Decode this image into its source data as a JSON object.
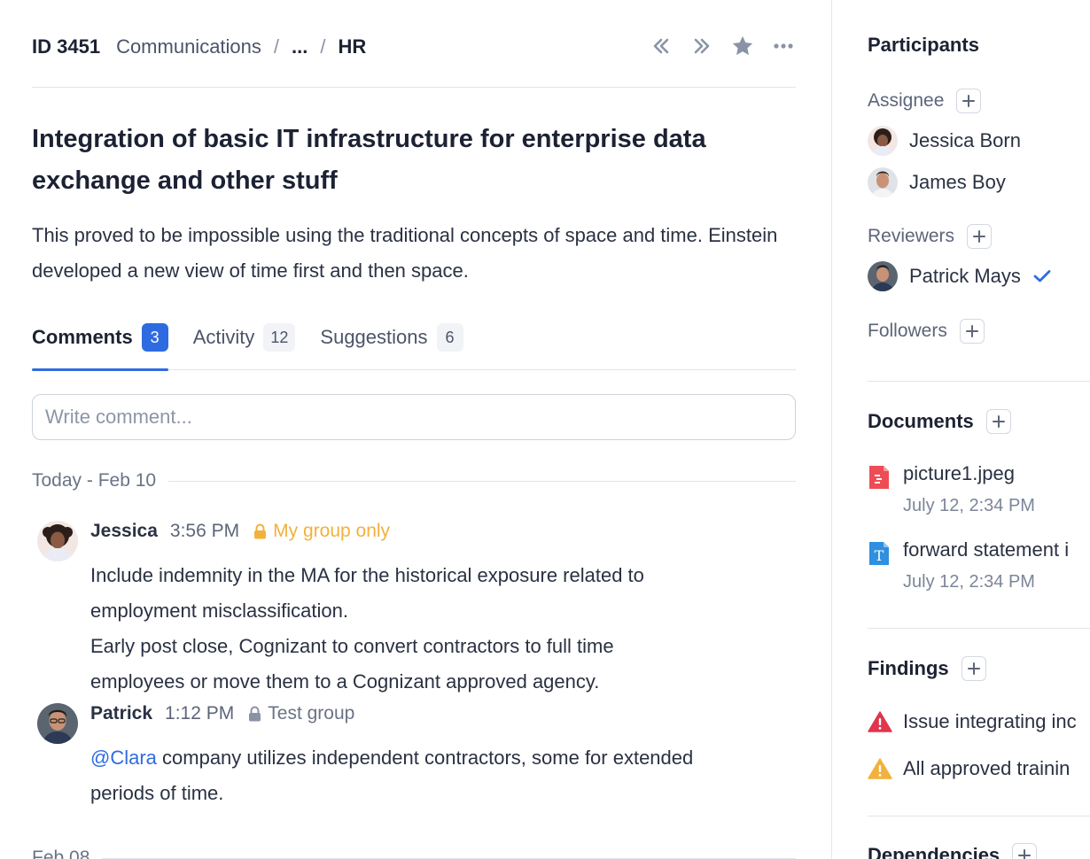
{
  "header": {
    "task_id": "ID 3451",
    "breadcrumb": [
      "Communications",
      "...",
      "HR"
    ],
    "separator": "/"
  },
  "task": {
    "title": "Integration of basic IT infrastructure for enterprise data exchange and other stuff",
    "description": "This proved to be impossible using the traditional concepts of space and time. Einstein developed a new view of time first and then space."
  },
  "tabs": [
    {
      "label": "Comments",
      "count": "3",
      "active": true
    },
    {
      "label": "Activity",
      "count": "12",
      "active": false
    },
    {
      "label": "Suggestions",
      "count": "6",
      "active": false
    }
  ],
  "comment_input": {
    "placeholder": "Write comment..."
  },
  "day_groups": [
    {
      "label": "Today - Feb 10"
    },
    {
      "label": "Feb 08"
    }
  ],
  "comments": [
    {
      "author": "Jessica",
      "time": "3:56 PM",
      "visibility": "My group only",
      "lines": [
        "Include indemnity in the MA for the historical exposure related to",
        "employment misclassification.",
        "Early post close, Cognizant to convert contractors to full time",
        "employees or move them to a Cognizant approved agency."
      ]
    },
    {
      "author": "Patrick",
      "time": "1:12 PM",
      "visibility": "Test group",
      "mention": "@Clara",
      "line1_rest": " company utilizes independent contractors, some for extended",
      "line2": "periods of time."
    }
  ],
  "sidebar": {
    "participants": {
      "heading": "Participants",
      "assignee_label": "Assignee",
      "assignees": [
        "Jessica Born",
        "James Boy"
      ],
      "reviewers_label": "Reviewers",
      "reviewers": [
        "Patrick Mays"
      ],
      "followers_label": "Followers"
    },
    "documents": {
      "heading": "Documents",
      "items": [
        {
          "name": "picture1.jpeg",
          "date": "July 12, 2:34 PM",
          "icon": "image-file-icon"
        },
        {
          "name": "forward statement i",
          "date": "July 12, 2:34 PM",
          "icon": "text-file-icon"
        }
      ]
    },
    "findings": {
      "heading": "Findings",
      "items": [
        {
          "text": "Issue integrating inc",
          "severity": "error"
        },
        {
          "text": "All approved trainin",
          "severity": "warning"
        }
      ]
    },
    "dependencies": {
      "heading": "Dependencies"
    }
  },
  "colors": {
    "accent": "#2f6be0",
    "warning": "#f2b13c",
    "error": "#e0354d",
    "text": "#1c2233"
  }
}
